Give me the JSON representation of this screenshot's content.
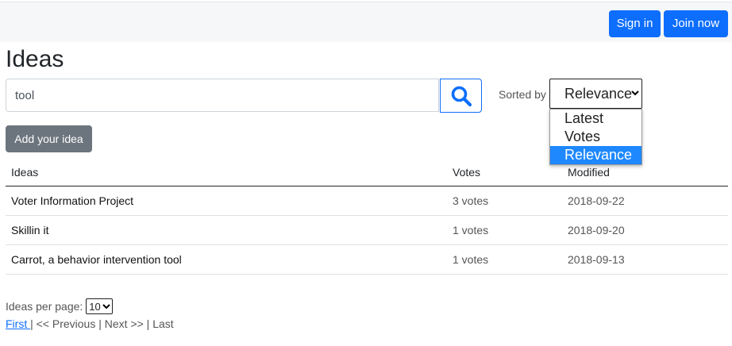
{
  "header": {
    "signin_label": "Sign in",
    "join_label": "Join now"
  },
  "page": {
    "title": "Ideas"
  },
  "search": {
    "value": "tool"
  },
  "sort": {
    "label": "Sorted by",
    "selected": "Relevance",
    "options": [
      "Latest",
      "Votes",
      "Relevance"
    ]
  },
  "add_button_label": "Add your idea",
  "table": {
    "headers": [
      "Ideas",
      "Votes",
      "Modified"
    ],
    "rows": [
      {
        "idea": "Voter Information Project",
        "votes": "3 votes",
        "modified": "2018-09-22"
      },
      {
        "idea": "Skillin it",
        "votes": "1 votes",
        "modified": "2018-09-20"
      },
      {
        "idea": "Carrot, a behavior intervention tool",
        "votes": "1 votes",
        "modified": "2018-09-13"
      }
    ]
  },
  "pagination": {
    "per_page_label": "Ideas per page:",
    "per_page_value": "10",
    "first": "First ",
    "sep1": "| << Previous | Next >> | Last"
  },
  "colors": {
    "primary": "#0d6efd",
    "secondary": "#6c757d",
    "highlight": "#1e88ff"
  }
}
